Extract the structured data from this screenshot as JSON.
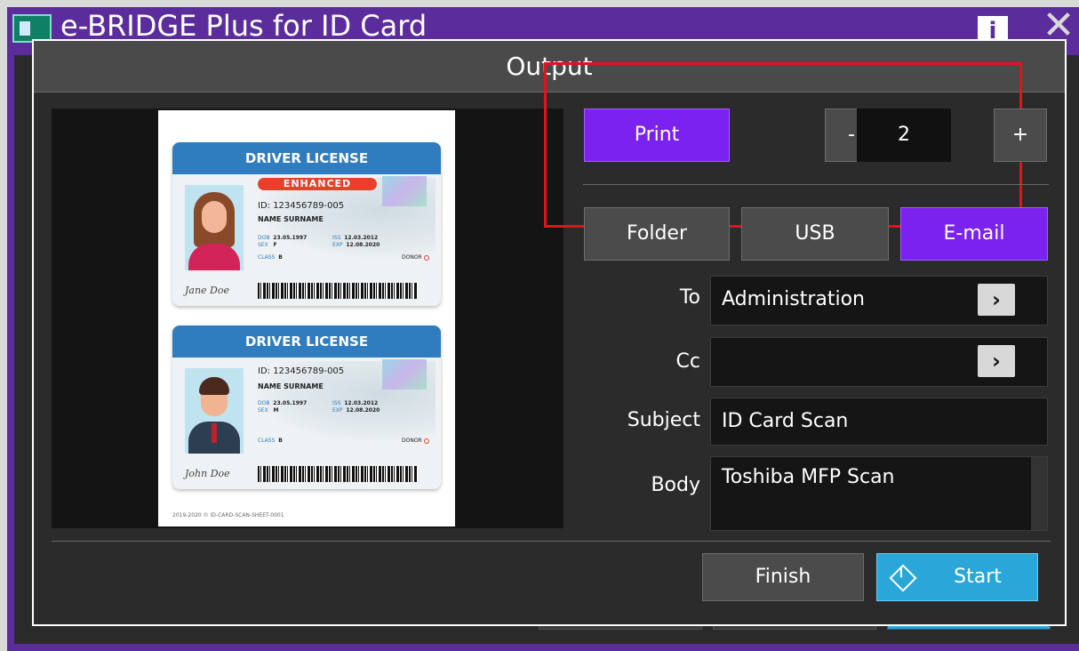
{
  "app": {
    "title": "e-BRIDGE Plus for ID Card",
    "info_icon": "info-icon",
    "close_icon": "close-icon"
  },
  "dialog": {
    "title": "Output"
  },
  "preview": {
    "cards": [
      {
        "header": "DRIVER LICENSE",
        "badge": "ENHANCED",
        "id": "ID: 123456789-005",
        "name": "NAME SURNAME",
        "dob_label": "DOB",
        "dob": "23.05.1997",
        "sex_label": "SEX",
        "sex": "F",
        "iss_label": "ISS",
        "iss": "12.03.2012",
        "exp_label": "EXP",
        "exp": "12.08.2020",
        "class_label": "CLASS",
        "class": "B",
        "donor": "DONOR",
        "signature": "Jane Doe"
      },
      {
        "header": "DRIVER LICENSE",
        "id": "ID: 123456789-005",
        "name": "NAME SURNAME",
        "dob_label": "DOB",
        "dob": "23.05.1997",
        "sex_label": "SEX",
        "sex": "M",
        "iss_label": "ISS",
        "iss": "12.03.2012",
        "exp_label": "EXP",
        "exp": "12.08.2020",
        "class_label": "CLASS",
        "class": "B",
        "donor": "DONOR",
        "signature": "John Doe"
      }
    ],
    "footer": "2019-2020 © ID-CARD-SCAN-SHEET-0001"
  },
  "output": {
    "print_label": "Print",
    "minus_label": "-",
    "quantity": "2",
    "plus_label": "+",
    "destinations": [
      "Folder",
      "USB",
      "E-mail"
    ],
    "selected_destination": "E-mail"
  },
  "email": {
    "to_label": "To",
    "to_value": "Administration",
    "cc_label": "Cc",
    "cc_value": "",
    "subject_label": "Subject",
    "subject_value": "ID Card Scan",
    "body_label": "Body",
    "body_value": "Toshiba MFP Scan",
    "chevron": "›"
  },
  "footer": {
    "finish_label": "Finish",
    "start_label": "Start"
  },
  "colors": {
    "accent_purple": "#7b22ee",
    "start_blue": "#2aa7d8",
    "highlight_red": "#e8101e",
    "frame_purple": "#5b2d9c"
  }
}
